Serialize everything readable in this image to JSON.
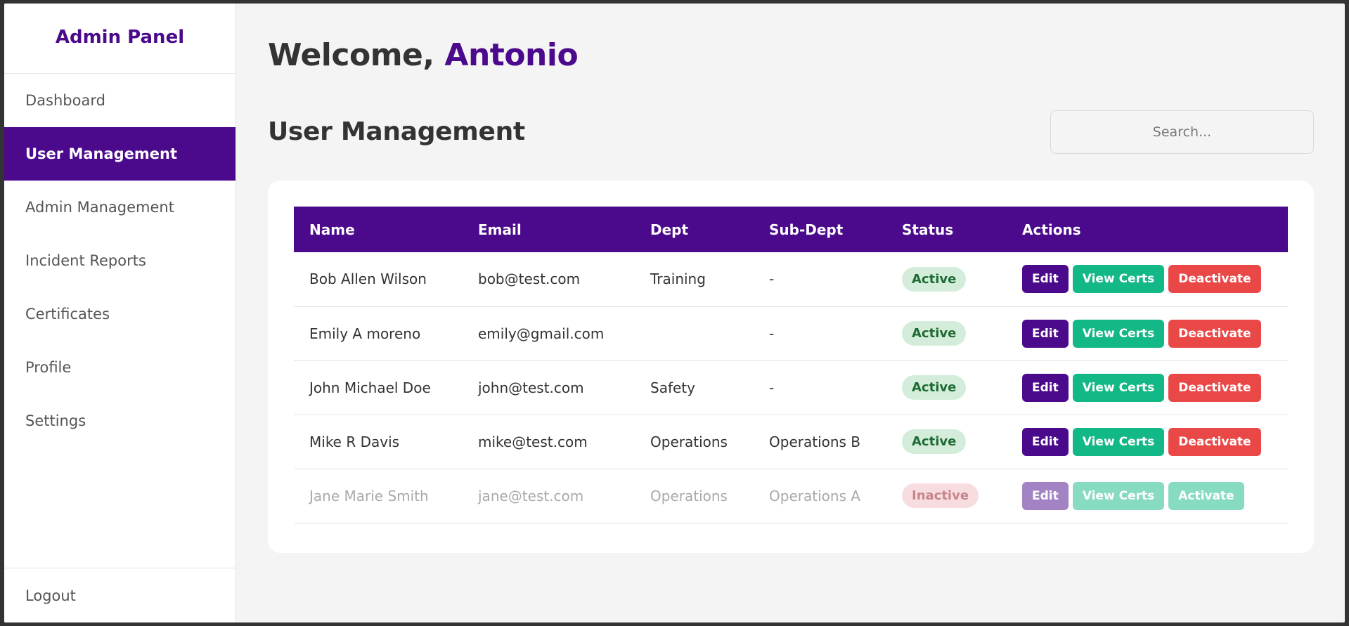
{
  "sidebar": {
    "brand": "Admin Panel",
    "items": [
      {
        "label": "Dashboard",
        "active": false
      },
      {
        "label": "User Management",
        "active": true
      },
      {
        "label": "Admin Management",
        "active": false
      },
      {
        "label": "Incident Reports",
        "active": false
      },
      {
        "label": "Certificates",
        "active": false
      },
      {
        "label": "Profile",
        "active": false
      },
      {
        "label": "Settings",
        "active": false
      }
    ],
    "logout": "Logout"
  },
  "header": {
    "welcome_prefix": "Welcome, ",
    "user_name": "Antonio"
  },
  "section": {
    "title": "User Management",
    "search_placeholder": "Search..."
  },
  "table": {
    "columns": [
      "Name",
      "Email",
      "Dept",
      "Sub-Dept",
      "Status",
      "Actions"
    ],
    "rows": [
      {
        "name": "Bob Allen Wilson",
        "email": "bob@test.com",
        "dept": "Training",
        "subdept": "-",
        "status": "Active",
        "actions": [
          "Edit",
          "View Certs",
          "Deactivate"
        ]
      },
      {
        "name": "Emily A moreno",
        "email": "emily@gmail.com",
        "dept": "",
        "subdept": "-",
        "status": "Active",
        "actions": [
          "Edit",
          "View Certs",
          "Deactivate"
        ]
      },
      {
        "name": "John Michael Doe",
        "email": "john@test.com",
        "dept": "Safety",
        "subdept": "-",
        "status": "Active",
        "actions": [
          "Edit",
          "View Certs",
          "Deactivate"
        ]
      },
      {
        "name": "Mike R Davis",
        "email": "mike@test.com",
        "dept": "Operations",
        "subdept": "Operations B",
        "status": "Active",
        "actions": [
          "Edit",
          "View Certs",
          "Deactivate"
        ]
      },
      {
        "name": "Jane Marie Smith",
        "email": "jane@test.com",
        "dept": "Operations",
        "subdept": "Operations A",
        "status": "Inactive",
        "actions": [
          "Edit",
          "View Certs",
          "Activate"
        ]
      }
    ]
  },
  "colors": {
    "brand": "#4b0a8c",
    "success": "#12b886",
    "danger": "#ea4747"
  }
}
